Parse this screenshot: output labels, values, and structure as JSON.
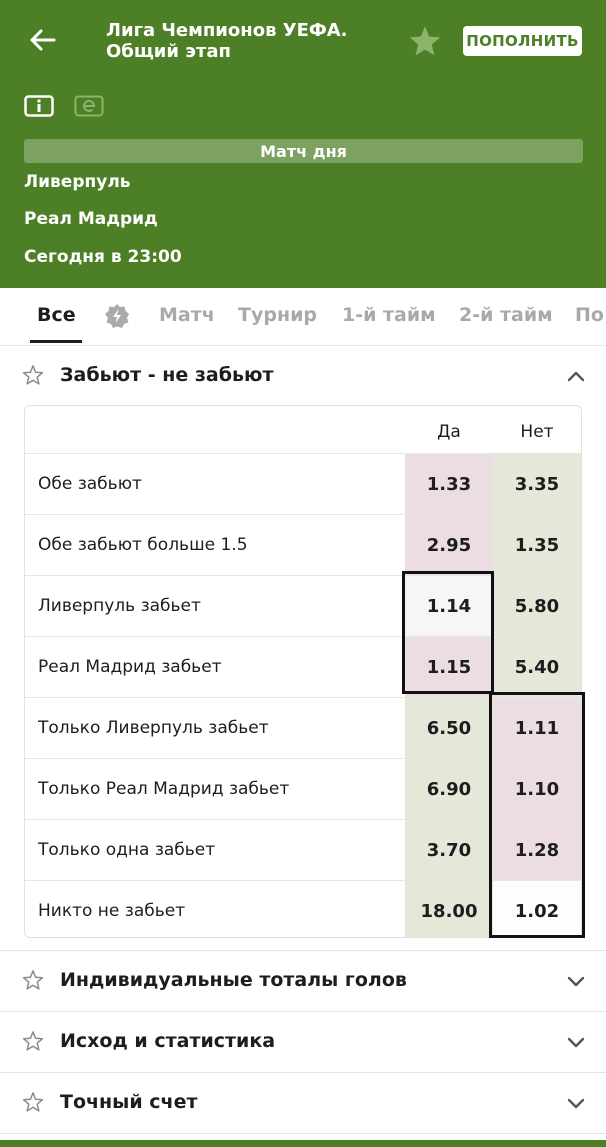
{
  "header": {
    "title": "Лига Чемпионов УЕФА. Общий этап",
    "topup_label": "ПОПОЛНИТЬ",
    "match_day_label": "Матч дня",
    "team1": "Ливерпуль",
    "team2": "Реал Мадрид",
    "kickoff": "Сегодня в 23:00",
    "bg_color": "#4d7f27"
  },
  "tabs": [
    {
      "label": "Все",
      "active": true
    },
    {
      "label": "Матч"
    },
    {
      "label": "Турнир"
    },
    {
      "label": "1-й тайм"
    },
    {
      "label": "2-й тайм"
    },
    {
      "label": "По"
    }
  ],
  "market": {
    "title": "Забьют - не забьют",
    "col_yes": "Да",
    "col_no": "Нет",
    "rows": [
      {
        "label": "Обе забьют",
        "yes": "1.33",
        "no": "3.35"
      },
      {
        "label": "Обе забьют больше 1.5",
        "yes": "2.95",
        "no": "1.35"
      },
      {
        "label": "Ливерпуль забьет",
        "yes": "1.14",
        "no": "5.80"
      },
      {
        "label": "Реал Мадрид забьет",
        "yes": "1.15",
        "no": "5.40"
      },
      {
        "label": "Только Ливерпуль забьет",
        "yes": "6.50",
        "no": "1.11"
      },
      {
        "label": "Только Реал Мадрид забьет",
        "yes": "6.90",
        "no": "1.10"
      },
      {
        "label": "Только одна забьет",
        "yes": "3.70",
        "no": "1.28"
      },
      {
        "label": "Никто не забьет",
        "yes": "18.00",
        "no": "1.02"
      }
    ]
  },
  "collapsed_sections": [
    {
      "title": "Индивидуальные тоталы голов"
    },
    {
      "title": "Исход и статистика"
    },
    {
      "title": "Точный счет"
    }
  ],
  "icons": [
    "back-arrow-icon",
    "star-icon",
    "info-icon",
    "e-icon",
    "bolt-icon",
    "chevron-up-icon",
    "chevron-down-icon"
  ]
}
